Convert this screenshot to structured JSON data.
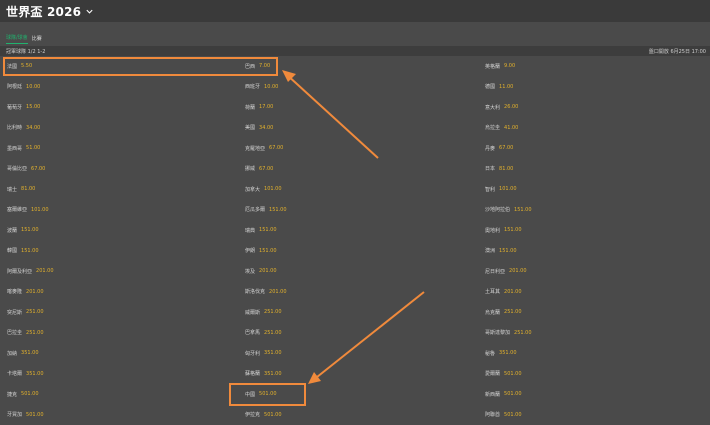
{
  "header": {
    "title": "世界盃 2026"
  },
  "tabs": [
    {
      "label": "球隊/球會"
    },
    {
      "label": "比賽"
    }
  ],
  "column_header": {
    "left": "冠軍球隊 1/2 1-2",
    "right": "盤口開放 6月25日 17:00"
  },
  "rows": [
    [
      {
        "team": "法國",
        "odds": "5.50"
      },
      {
        "team": "巴西",
        "odds": "7.00"
      },
      {
        "team": "英格蘭",
        "odds": "9.00"
      }
    ],
    [
      {
        "team": "阿根廷",
        "odds": "10.00"
      },
      {
        "team": "西班牙",
        "odds": "10.00"
      },
      {
        "team": "德國",
        "odds": "11.00"
      }
    ],
    [
      {
        "team": "葡萄牙",
        "odds": "15.00"
      },
      {
        "team": "荷蘭",
        "odds": "17.00"
      },
      {
        "team": "意大利",
        "odds": "26.00"
      }
    ],
    [
      {
        "team": "比利時",
        "odds": "34.00"
      },
      {
        "team": "美國",
        "odds": "34.00"
      },
      {
        "team": "烏拉圭",
        "odds": "41.00"
      }
    ],
    [
      {
        "team": "墨西哥",
        "odds": "51.00"
      },
      {
        "team": "克羅地亞",
        "odds": "67.00"
      },
      {
        "team": "丹麥",
        "odds": "67.00"
      }
    ],
    [
      {
        "team": "哥倫比亞",
        "odds": "67.00"
      },
      {
        "team": "挪威",
        "odds": "67.00"
      },
      {
        "team": "日本",
        "odds": "81.00"
      }
    ],
    [
      {
        "team": "瑞士",
        "odds": "81.00"
      },
      {
        "team": "加拿大",
        "odds": "101.00"
      },
      {
        "team": "智利",
        "odds": "101.00"
      }
    ],
    [
      {
        "team": "塞爾維亞",
        "odds": "101.00"
      },
      {
        "team": "厄瓜多爾",
        "odds": "151.00"
      },
      {
        "team": "沙地阿拉伯",
        "odds": "151.00"
      }
    ],
    [
      {
        "team": "波蘭",
        "odds": "151.00"
      },
      {
        "team": "瑞典",
        "odds": "151.00"
      },
      {
        "team": "奧地利",
        "odds": "151.00"
      }
    ],
    [
      {
        "team": "韓國",
        "odds": "151.00"
      },
      {
        "team": "伊朗",
        "odds": "151.00"
      },
      {
        "team": "澳洲",
        "odds": "151.00"
      }
    ],
    [
      {
        "team": "阿爾及利亞",
        "odds": "201.00"
      },
      {
        "team": "埃及",
        "odds": "201.00"
      },
      {
        "team": "尼日利亞",
        "odds": "201.00"
      }
    ],
    [
      {
        "team": "喀麥隆",
        "odds": "201.00"
      },
      {
        "team": "斯洛伐克",
        "odds": "201.00"
      },
      {
        "team": "土耳其",
        "odds": "201.00"
      }
    ],
    [
      {
        "team": "突尼斯",
        "odds": "251.00"
      },
      {
        "team": "威爾斯",
        "odds": "251.00"
      },
      {
        "team": "烏克蘭",
        "odds": "251.00"
      }
    ],
    [
      {
        "team": "巴拉圭",
        "odds": "251.00"
      },
      {
        "team": "巴拿馬",
        "odds": "251.00"
      },
      {
        "team": "哥斯達黎加",
        "odds": "251.00"
      }
    ],
    [
      {
        "team": "加納",
        "odds": "351.00"
      },
      {
        "team": "匈牙利",
        "odds": "351.00"
      },
      {
        "team": "秘魯",
        "odds": "351.00"
      }
    ],
    [
      {
        "team": "卡塔爾",
        "odds": "351.00"
      },
      {
        "team": "蘇格蘭",
        "odds": "351.00"
      },
      {
        "team": "愛爾蘭",
        "odds": "501.00"
      }
    ],
    [
      {
        "team": "捷克",
        "odds": "501.00"
      },
      {
        "team": "中國",
        "odds": "501.00"
      },
      {
        "team": "新西蘭",
        "odds": "501.00"
      }
    ],
    [
      {
        "team": "牙買加",
        "odds": "501.00"
      },
      {
        "team": "伊拉克",
        "odds": "501.00"
      },
      {
        "team": "阿聯酋",
        "odds": "501.00"
      }
    ]
  ],
  "colors": {
    "background": "#4a4a4a",
    "odds": "#e2b12c",
    "accent": "#21b26e",
    "highlight": "#f08a3c"
  }
}
